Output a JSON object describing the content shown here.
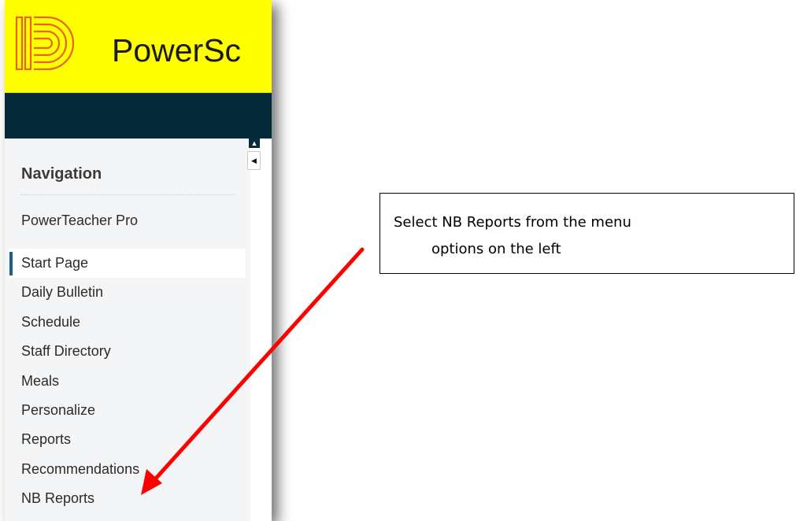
{
  "app": {
    "brand_text": "PowerSc",
    "brand_color": "#ffff00",
    "navbar_color": "#052a3a",
    "logo_color": "#e8631c"
  },
  "sidebar": {
    "heading": "Navigation",
    "ptp_link": "PowerTeacher Pro",
    "items": [
      {
        "label": "Start Page",
        "active": true
      },
      {
        "label": "Daily Bulletin"
      },
      {
        "label": "Schedule"
      },
      {
        "label": "Staff Directory"
      },
      {
        "label": "Meals"
      },
      {
        "label": "Personalize"
      },
      {
        "label": "Reports"
      },
      {
        "label": "Recommendations"
      },
      {
        "label": "NB Reports"
      }
    ]
  },
  "callout": {
    "line1": "Select NB Reports from the menu",
    "line2": "options on the left"
  },
  "annotation": {
    "arrow_color": "#ff0000",
    "arrow_icon": "red-arrow-icon"
  }
}
